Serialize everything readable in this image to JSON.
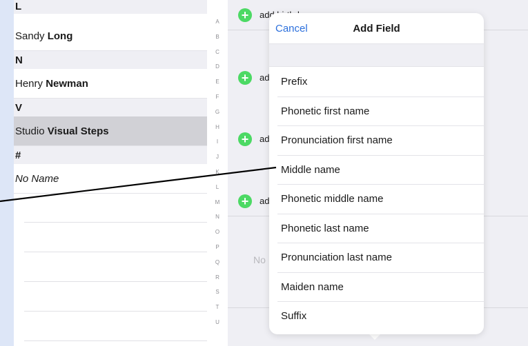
{
  "contacts": {
    "sections": [
      {
        "letter": "L",
        "contacts": [
          {
            "first": "Sandy",
            "last": "Long"
          }
        ]
      },
      {
        "letter": "N",
        "contacts": [
          {
            "first": "Henry",
            "last": "Newman"
          }
        ]
      },
      {
        "letter": "V",
        "contacts": [
          {
            "first": "Studio",
            "last": "Visual Steps"
          }
        ]
      },
      {
        "letter": "#",
        "contacts": [
          {
            "first": "No Name",
            "last": ""
          }
        ]
      }
    ]
  },
  "index_letters": [
    "A",
    "B",
    "C",
    "D",
    "E",
    "F",
    "G",
    "H",
    "I",
    "J",
    "K",
    "L",
    "M",
    "N",
    "O",
    "P",
    "Q",
    "R",
    "S",
    "T",
    "U"
  ],
  "detail": {
    "add_birthday": "add birthday",
    "add_truncated": "ad",
    "notes_fragment": "No"
  },
  "popover": {
    "cancel": "Cancel",
    "title": "Add Field",
    "fields": [
      "Prefix",
      "Phonetic first name",
      "Pronunciation first name",
      "Middle name",
      "Phonetic middle name",
      "Phonetic last name",
      "Pronunciation last name",
      "Maiden name",
      "Suffix"
    ]
  },
  "colors": {
    "accent": "#2b6fdc",
    "add": "#4cd964",
    "selected": "#d1d1d6"
  }
}
